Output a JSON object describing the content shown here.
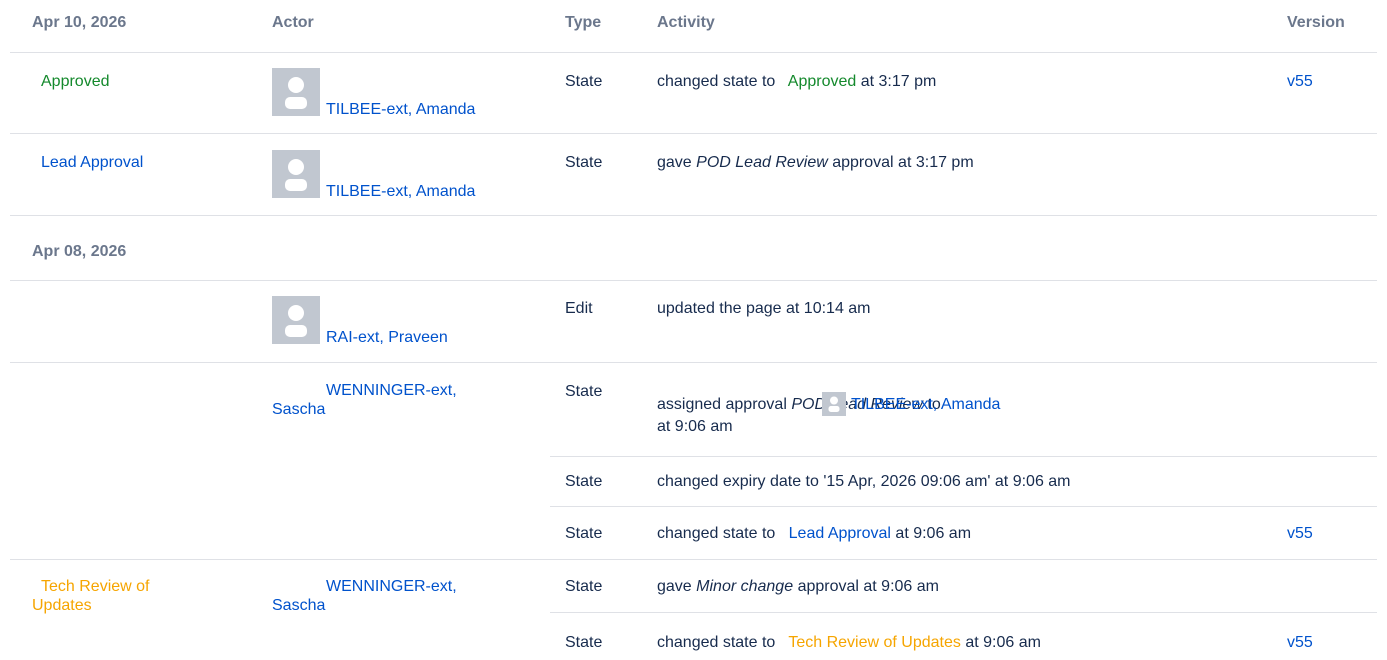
{
  "headers": {
    "date": "Apr 10, 2026",
    "actor": "Actor",
    "type": "Type",
    "activity": "Activity",
    "version": "Version"
  },
  "groups": [
    {
      "date": "Apr 08, 2026"
    }
  ],
  "rows": [
    {
      "status": "Approved",
      "actor": "TILBEE-ext, Amanda",
      "type": "State",
      "activity_pre": "changed state to",
      "activity_state": "Approved",
      "activity_post": "at 3:17 pm",
      "version": "v55"
    },
    {
      "status": "Lead Approval",
      "actor": "TILBEE-ext, Amanda",
      "type": "State",
      "activity_pre": "gave",
      "activity_em": "POD Lead Review",
      "activity_post": "approval at 3:17 pm"
    },
    {
      "actor": "RAI-ext, Praveen",
      "type": "Edit",
      "activity": "updated the page at 10:14 am"
    },
    {
      "actor_line1": "WENNINGER-ext,",
      "actor_line2": "Sascha",
      "type": "State",
      "activity_pre": "assigned approval",
      "activity_em": "POD Lead Review",
      "activity_mid": "to",
      "activity_user": "TILBEE-ext, Amanda",
      "activity_post": "at 9:06 am"
    },
    {
      "type": "State",
      "activity": "changed expiry date to '15 Apr, 2026 09:06 am' at 9:06 am"
    },
    {
      "type": "State",
      "activity_pre": "changed state to",
      "activity_state": "Lead Approval",
      "activity_post": "at 9:06 am",
      "version": "v55"
    },
    {
      "status_line1": "Tech Review of",
      "status_line2": "Updates",
      "actor_line1": "WENNINGER-ext,",
      "actor_line2": "Sascha",
      "type": "State",
      "activity_pre": "gave",
      "activity_em": "Minor change",
      "activity_post": "approval at 9:06 am"
    },
    {
      "type": "State",
      "activity_pre": "changed state to",
      "activity_state": "Tech Review of Updates",
      "activity_post": "at 9:06 am",
      "version": "v55"
    }
  ],
  "colors": {
    "approved": "#14892c",
    "lead_approval": "#0052cc",
    "tech_review": "#f6a500",
    "link": "#0052cc"
  }
}
